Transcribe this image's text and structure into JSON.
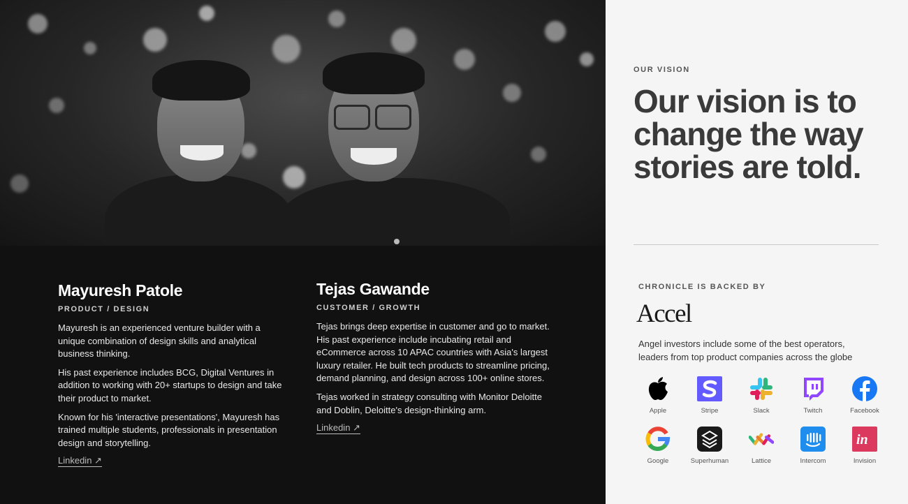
{
  "team": [
    {
      "name": "Mayuresh Patole",
      "role": "PRODUCT / DESIGN",
      "paragraphs": [
        "Mayuresh is an experienced venture builder with a unique combination of design skills and analytical business thinking.",
        "His past experience includes BCG, Digital Ventures in addition to working with 20+ startups to design and take their product to market.",
        "Known for his 'interactive presentations', Mayuresh has trained multiple students, professionals in presentation design and storytelling."
      ],
      "link": "Linkedin ↗"
    },
    {
      "name": "Tejas Gawande",
      "role": "CUSTOMER / GROWTH",
      "paragraphs": [
        "Tejas brings deep expertise in customer and go to market. His past experience include incubating retail and eCommerce across 10 APAC countries with Asia's largest luxury retailer. He built tech products to streamline pricing, demand planning, and design across 100+ online stores.",
        "Tejas worked in strategy consulting with Monitor Deloitte and Doblin, Deloitte's design-thinking arm."
      ],
      "link": "Linkedin ↗"
    }
  ],
  "vision": {
    "eyebrow": "OUR VISION",
    "statement": "Our vision is to change the way stories are told."
  },
  "backers": {
    "eyebrow": "CHRONICLE IS BACKED BY",
    "lead": "Accel",
    "description": "Angel investors include some of the best operators, leaders from top product companies across the globe",
    "logos": [
      {
        "name": "Apple",
        "icon": "apple-logo",
        "color": "#000000"
      },
      {
        "name": "Stripe",
        "icon": "stripe-logo",
        "color": "#635bff"
      },
      {
        "name": "Slack",
        "icon": "slack-logo",
        "color": "#e01e5a"
      },
      {
        "name": "Twitch",
        "icon": "twitch-logo",
        "color": "#9146ff"
      },
      {
        "name": "Facebook",
        "icon": "facebook-logo",
        "color": "#1877f2"
      },
      {
        "name": "Google",
        "icon": "google-logo",
        "color": "#4285f4"
      },
      {
        "name": "Superhuman",
        "icon": "superhuman-logo",
        "color": "#1a1a1a"
      },
      {
        "name": "Lattice",
        "icon": "lattice-logo",
        "color": "#e87f2d"
      },
      {
        "name": "Intercom",
        "icon": "intercom-logo",
        "color": "#1f8ded"
      },
      {
        "name": "Invision",
        "icon": "invision-logo",
        "color": "#ff3366"
      }
    ]
  }
}
